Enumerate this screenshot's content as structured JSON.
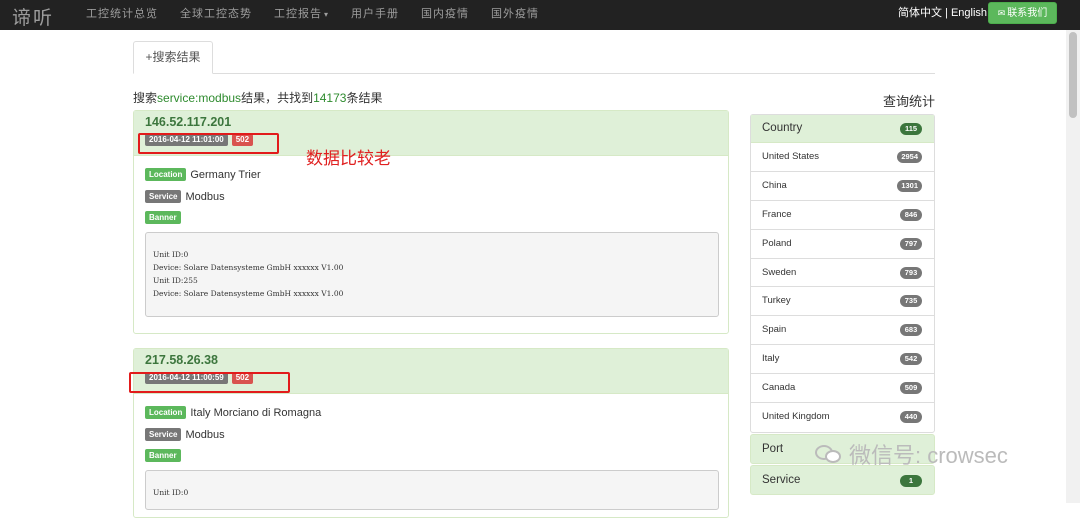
{
  "nav": {
    "brand": "谛听",
    "items": [
      "工控统计总览",
      "全球工控态势",
      "工控报告",
      "用户手册",
      "国内疫情",
      "国外疫情"
    ],
    "lang": "简体中文 | English",
    "contact": "联系我们"
  },
  "tab": {
    "label": "+搜索结果"
  },
  "summary": {
    "prefix": "搜索",
    "query": "service:modbus",
    "mid": "结果，共找到",
    "count": "14173",
    "suffix": "条结果"
  },
  "annotation": "数据比较老",
  "labels": {
    "location": "Location",
    "service": "Service",
    "banner": "Banner"
  },
  "results": [
    {
      "ip": "146.52.117.201",
      "time": "2016-04-12 11:01:00",
      "code": "502",
      "location": "Germany Trier",
      "service": "Modbus",
      "banner": "Unit ID:0\nDevice: Solare Datensysteme GmbH xxxxxx V1.00\nUnit ID:255\nDevice: Solare Datensysteme GmbH xxxxxx V1.00"
    },
    {
      "ip": "217.58.26.38",
      "time": "2016-04-12 11:00:59",
      "code": "502",
      "location": "Italy Morciano di Romagna",
      "service": "Modbus",
      "banner": "Unit ID:0"
    }
  ],
  "stats": {
    "title": "查询统计",
    "country_label": "Country",
    "country_count": "115",
    "countries": [
      {
        "name": "United States",
        "count": "2954"
      },
      {
        "name": "China",
        "count": "1301"
      },
      {
        "name": "France",
        "count": "846"
      },
      {
        "name": "Poland",
        "count": "797"
      },
      {
        "name": "Sweden",
        "count": "793"
      },
      {
        "name": "Turkey",
        "count": "735"
      },
      {
        "name": "Spain",
        "count": "683"
      },
      {
        "name": "Italy",
        "count": "542"
      },
      {
        "name": "Canada",
        "count": "509"
      },
      {
        "name": "United Kingdom",
        "count": "440"
      }
    ],
    "port_label": "Port",
    "service_label": "Service",
    "service_count": "1"
  },
  "watermark": "微信号: crowsec",
  "colors": {
    "accent_green": "#5cb85c",
    "panel_green": "#dff0d8",
    "alert_red": "#d9534f",
    "annotation_red": "#e21b1b"
  }
}
